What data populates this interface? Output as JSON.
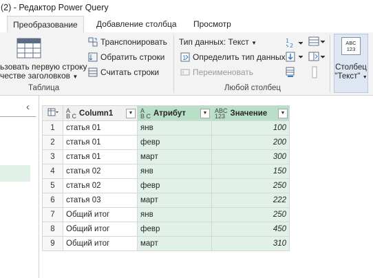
{
  "window": {
    "title": "(2) - Редактор Power Query"
  },
  "tabs": [
    {
      "label": "Преобразование",
      "active": true
    },
    {
      "label": "Добавление столбца"
    },
    {
      "label": "Просмотр"
    }
  ],
  "ribbon": {
    "table_group": {
      "label": "Таблица",
      "use_first_row_line1": "ьзовать первую строку",
      "use_first_row_line2": "честве заголовков",
      "transpose": "Транспонировать",
      "reverse_rows": "Обратить строки",
      "count_rows": "Считать строки"
    },
    "any_column_group": {
      "label": "Любой столбец",
      "data_type": "Тип данных: Текст",
      "detect_type": "Определить тип данных",
      "rename": "Переименовать"
    },
    "text_column": {
      "icon_line1": "ABC",
      "icon_line2": "123",
      "label_line1": "Столбец",
      "label_line2": "\"Текст\""
    }
  },
  "grid": {
    "columns": [
      {
        "type_top": "A",
        "type_bottom": "B C",
        "label": "Column1"
      },
      {
        "type_top": "A",
        "type_bottom": "B C",
        "label": "Атрибут"
      },
      {
        "type_top": "ABC",
        "type_bottom": "123",
        "label": "Значение"
      }
    ],
    "rows": [
      {
        "n": "1",
        "c1": "статья 01",
        "attr": "янв",
        "val": "100"
      },
      {
        "n": "2",
        "c1": "статья 01",
        "attr": "февр",
        "val": "200"
      },
      {
        "n": "3",
        "c1": "статья 01",
        "attr": "март",
        "val": "300"
      },
      {
        "n": "4",
        "c1": "статья 02",
        "attr": "янв",
        "val": "150"
      },
      {
        "n": "5",
        "c1": "статья 02",
        "attr": "февр",
        "val": "250"
      },
      {
        "n": "6",
        "c1": "статья 03",
        "attr": "март",
        "val": "222"
      },
      {
        "n": "7",
        "c1": "Общий итог",
        "attr": "янв",
        "val": "250"
      },
      {
        "n": "8",
        "c1": "Общий итог",
        "attr": "февр",
        "val": "450"
      },
      {
        "n": "9",
        "c1": "Общий итог",
        "attr": "март",
        "val": "310"
      }
    ]
  },
  "colors": {
    "accent_green": "#b9dfc8",
    "cell_green": "#e2f1e8",
    "ribbon_bg": "#f3f3f3"
  }
}
